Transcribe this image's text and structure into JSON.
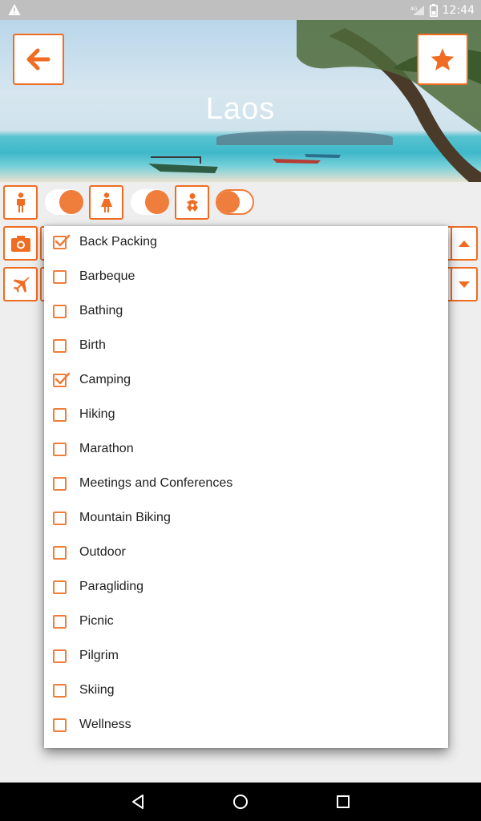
{
  "status_bar": {
    "time": "12:44",
    "network": "4G"
  },
  "header": {
    "title": "Laos"
  },
  "colors": {
    "accent": "#ef6c22",
    "toggle": "#ef7d3c"
  },
  "filters": {
    "icons": [
      "male-icon",
      "female-icon",
      "baby-icon"
    ],
    "toggles": [
      {
        "state": "on"
      },
      {
        "state": "on"
      },
      {
        "state": "off"
      }
    ]
  },
  "dropdown": {
    "items": [
      {
        "label": "Back Packing",
        "checked": true
      },
      {
        "label": "Barbeque",
        "checked": false
      },
      {
        "label": "Bathing",
        "checked": false
      },
      {
        "label": "Birth",
        "checked": false
      },
      {
        "label": "Camping",
        "checked": true
      },
      {
        "label": "Hiking",
        "checked": false
      },
      {
        "label": "Marathon",
        "checked": false
      },
      {
        "label": "Meetings and Conferences",
        "checked": false
      },
      {
        "label": "Mountain Biking",
        "checked": false
      },
      {
        "label": "Outdoor",
        "checked": false
      },
      {
        "label": "Paragliding",
        "checked": false
      },
      {
        "label": "Picnic",
        "checked": false
      },
      {
        "label": "Pilgrim",
        "checked": false
      },
      {
        "label": "Skiing",
        "checked": false
      },
      {
        "label": "Wellness",
        "checked": false
      }
    ]
  }
}
